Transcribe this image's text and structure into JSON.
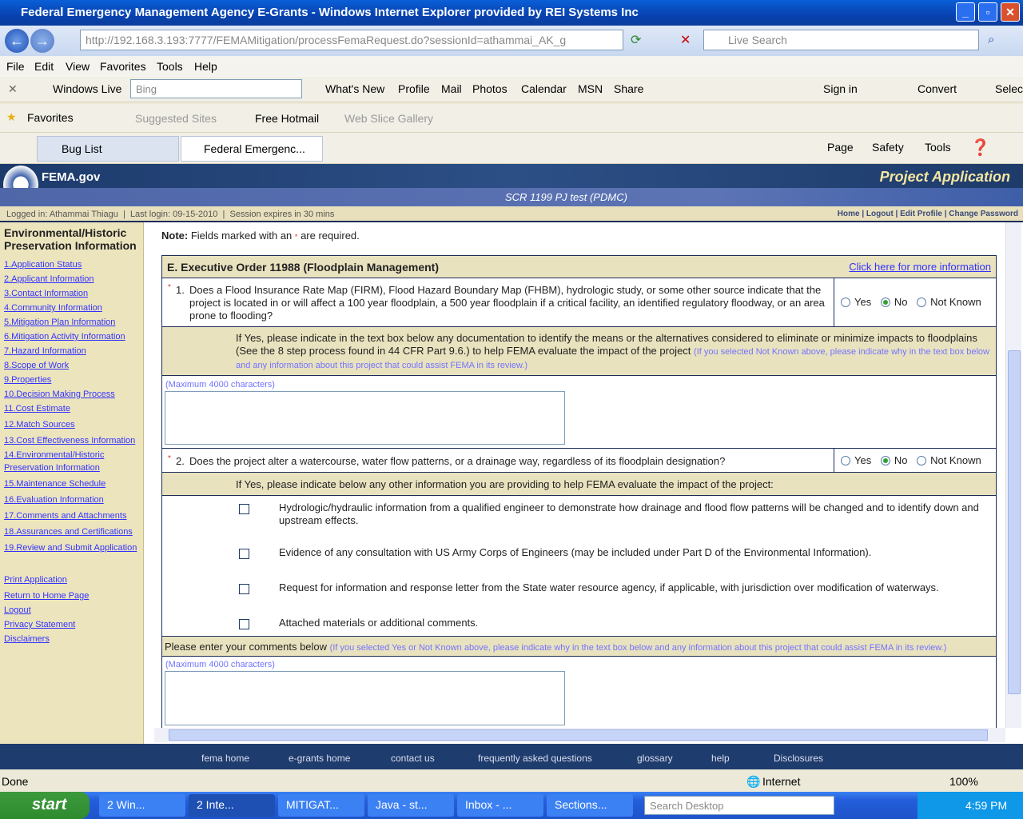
{
  "window": {
    "title": "Federal Emergency Management Agency E-Grants - Windows Internet Explorer provided by REI Systems Inc"
  },
  "address": {
    "url": "http://192.168.3.193:7777/FEMAMitigation/processFemaRequest.do?sessionId=athammai_AK_g",
    "search_placeholder": "Live Search"
  },
  "menu": [
    "File",
    "Edit",
    "View",
    "Favorites",
    "Tools",
    "Help"
  ],
  "live_toolbar": {
    "brand": "Windows Live",
    "search_placeholder": "Bing",
    "items": [
      "What's New",
      "Profile",
      "Mail",
      "Photos",
      "Calendar",
      "MSN",
      "Share"
    ],
    "sign_in": "Sign in",
    "convert": "Convert",
    "select": "Selec"
  },
  "favorites_bar": {
    "favorites": "Favorites",
    "items": [
      "Suggested Sites",
      "Free Hotmail",
      "Web Slice Gallery"
    ]
  },
  "tabs": [
    {
      "label": "Bug List"
    },
    {
      "label": "Federal Emergenc..."
    }
  ],
  "command_bar": [
    "Page",
    "Safety",
    "Tools"
  ],
  "site": {
    "logo": "FEMA.gov",
    "section": "Project Application",
    "project": "SCR 1199 PJ test (PDMC)",
    "logged_in": "Logged in: Athammai Thiagu",
    "last_login": "Last login: 09-15-2010",
    "session": "Session expires in 30 mins",
    "top_links": [
      "Home",
      "Logout",
      "Edit Profile",
      "Change Password"
    ]
  },
  "sidebar": {
    "title": "Environmental/Historic Preservation Information",
    "links": [
      "1.Application Status",
      "2.Applicant Information",
      "3.Contact Information",
      "4.Community Information",
      "5.Mitigation Plan Information",
      "6.Mitigation Activity Information",
      "7.Hazard Information",
      "8.Scope of Work",
      "9.Properties",
      "10.Decision Making Process",
      "11.Cost Estimate",
      "12.Match Sources",
      "13.Cost Effectiveness Information",
      "14.Environmental/Historic Preservation Information",
      "15.Maintenance Schedule",
      "16.Evaluation Information",
      "17.Comments and Attachments",
      "18.Assurances and Certifications",
      "19.Review and Submit Application"
    ],
    "extra_links": [
      "Print Application",
      "Return to Home Page",
      "Logout",
      "Privacy Statement",
      "Disclaimers"
    ]
  },
  "form": {
    "note_label": "Note:",
    "note_text": "Fields marked with an",
    "note_star": "*",
    "note_end": "are required.",
    "section_title": "E. Executive Order 11988 (Floodplain Management)",
    "more_info": "Click here for more information",
    "options": [
      "Yes",
      "No",
      "Not Known"
    ],
    "q1": {
      "number": "1.",
      "text": "Does a Flood Insurance Rate Map (FIRM), Flood Hazard Boundary Map (FHBM), hydrologic study, or some other source indicate that the project is located in or will affect a 100 year floodplain, a 500 year floodplain if a critical facility, an identified regulatory floodway, or an area prone to flooding?",
      "selected": "No"
    },
    "q1_followup": "If Yes, please indicate in the text box below any documentation to identify the means or the alternatives considered to eliminate or minimize impacts to floodplains (See the 8 step process found in 44 CFR Part 9.6.) to help FEMA evaluate the impact of the project",
    "q1_hint": "(If you selected Not Known above, please indicate why in the text box below and any information about this project that could assist FEMA in its review.)",
    "max_chars": "(Maximum 4000 characters)",
    "q2": {
      "number": "2.",
      "text": "Does the project alter a watercourse, water flow patterns, or a drainage way, regardless of its floodplain designation?",
      "selected": "No"
    },
    "q2_followup": "If Yes, please indicate below any other information you are providing to help FEMA evaluate the impact of the project:",
    "checkboxes": [
      "Hydrologic/hydraulic information from a qualified engineer to demonstrate how drainage and flood flow patterns will be changed and to identify down and upstream effects.",
      "Evidence of any consultation with US Army Corps of Engineers (may be included under Part D of the Environmental Information).",
      "Request for information and response letter from the State water resource agency, if applicable, with jurisdiction over modification of waterways.",
      "Attached materials or additional comments."
    ],
    "comments_label": "Please enter your comments below",
    "comments_hint": "(If you selected Yes or Not Known above, please indicate why in the text box below and any information about this project that could assist FEMA in its review.)"
  },
  "footer": [
    "fema home",
    "e-grants home",
    "contact us",
    "frequently asked questions",
    "glossary",
    "help",
    "Disclosures"
  ],
  "status": {
    "text": "Done",
    "zone": "Internet",
    "zoom": "100%"
  },
  "taskbar": {
    "start": "start",
    "tasks": [
      "2 Win...",
      "2 Inte...",
      "MITIGAT...",
      "Java - st...",
      "Inbox - ...",
      "Sections..."
    ],
    "search_placeholder": "Search Desktop",
    "clock": "4:59 PM"
  },
  "colors": {
    "header_dark": "#1d3a6b",
    "tan": "#e9e2bf",
    "link": "#3333ff"
  }
}
